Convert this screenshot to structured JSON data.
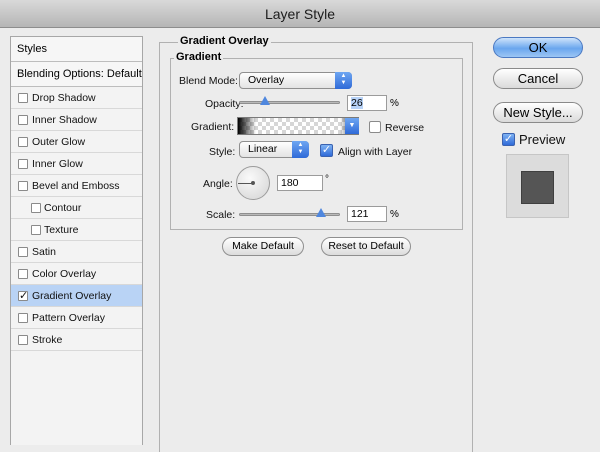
{
  "window": {
    "title": "Layer Style"
  },
  "sidebar": {
    "header": "Styles",
    "blending_options": "Blending Options: Default",
    "items": [
      {
        "label": "Drop Shadow",
        "checked": false,
        "indent": false,
        "selected": false
      },
      {
        "label": "Inner Shadow",
        "checked": false,
        "indent": false,
        "selected": false
      },
      {
        "label": "Outer Glow",
        "checked": false,
        "indent": false,
        "selected": false
      },
      {
        "label": "Inner Glow",
        "checked": false,
        "indent": false,
        "selected": false
      },
      {
        "label": "Bevel and Emboss",
        "checked": false,
        "indent": false,
        "selected": false
      },
      {
        "label": "Contour",
        "checked": false,
        "indent": true,
        "selected": false
      },
      {
        "label": "Texture",
        "checked": false,
        "indent": true,
        "selected": false
      },
      {
        "label": "Satin",
        "checked": false,
        "indent": false,
        "selected": false
      },
      {
        "label": "Color Overlay",
        "checked": false,
        "indent": false,
        "selected": false
      },
      {
        "label": "Gradient Overlay",
        "checked": true,
        "indent": false,
        "selected": true
      },
      {
        "label": "Pattern Overlay",
        "checked": false,
        "indent": false,
        "selected": false
      },
      {
        "label": "Stroke",
        "checked": false,
        "indent": false,
        "selected": false
      }
    ]
  },
  "panel": {
    "section_title": "Gradient Overlay",
    "group_title": "Gradient",
    "blend_mode": {
      "label": "Blend Mode:",
      "value": "Overlay"
    },
    "opacity": {
      "label": "Opacity:",
      "value": "26",
      "unit": "%",
      "level": 0.26
    },
    "gradient": {
      "label": "Gradient:",
      "reverse_label": "Reverse",
      "reverse_checked": false
    },
    "style": {
      "label": "Style:",
      "value": "Linear",
      "align_label": "Align with Layer",
      "align_checked": true
    },
    "angle": {
      "label": "Angle:",
      "value": "180",
      "unit": "°"
    },
    "scale": {
      "label": "Scale:",
      "value": "121",
      "unit": "%",
      "level": 0.81
    },
    "make_default": "Make Default",
    "reset_default": "Reset to Default"
  },
  "actions": {
    "ok": "OK",
    "cancel": "Cancel",
    "new_style": "New Style...",
    "preview_label": "Preview",
    "preview_checked": true
  },
  "colors": {
    "selection": "#b9d3f5",
    "accent": "#2f6ad8",
    "preview_swatch": "#555555"
  }
}
